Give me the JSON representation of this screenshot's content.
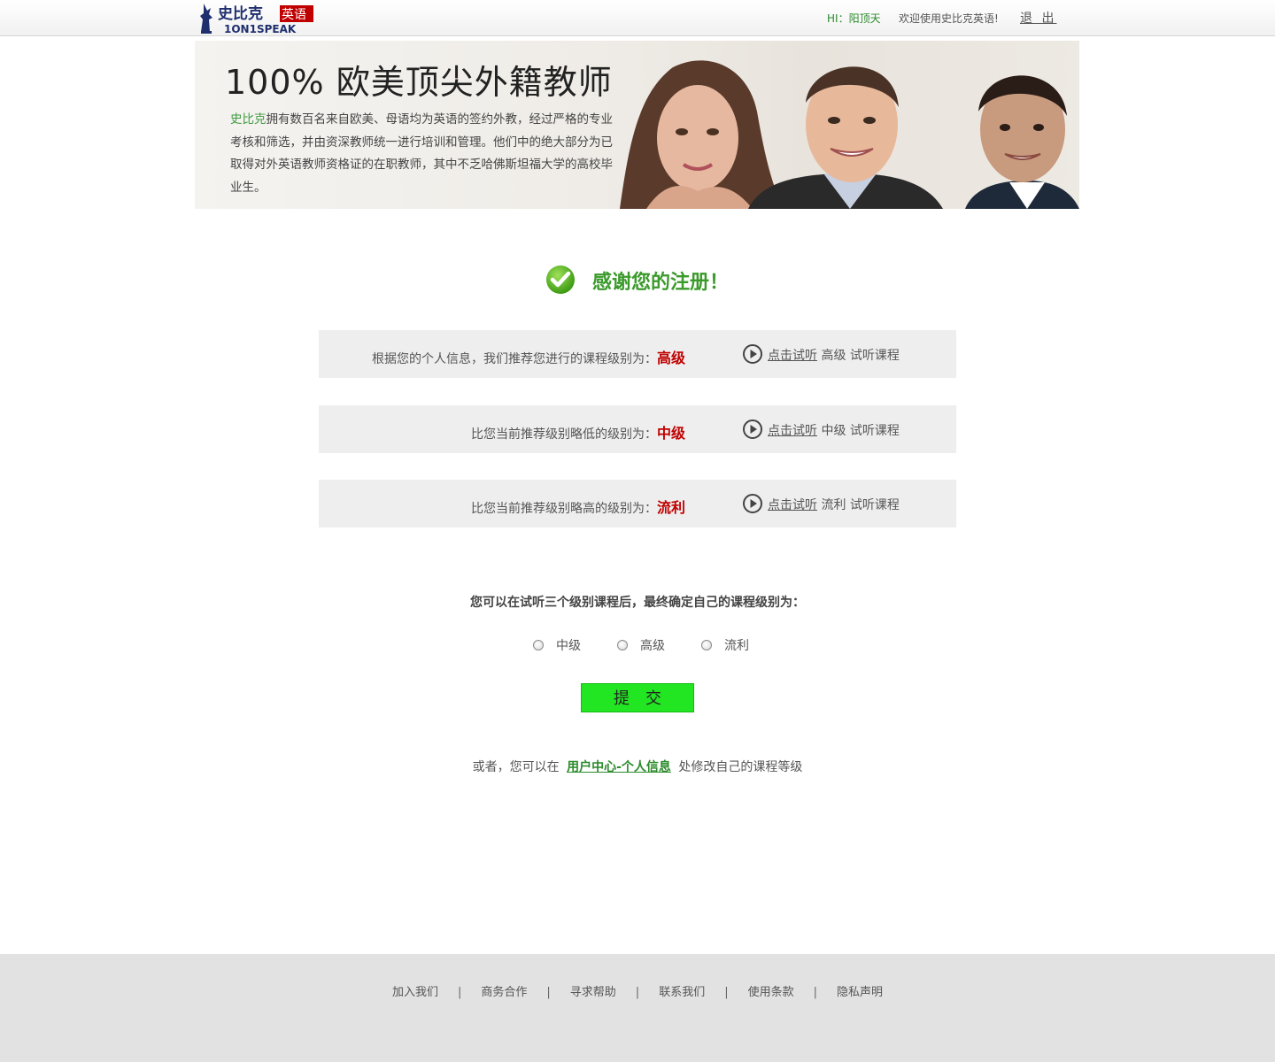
{
  "header": {
    "logo_cn": "史比克",
    "logo_badge": "英语",
    "logo_en": "1ON1SPEAK",
    "greeting_prefix": "HI：",
    "username": "阳顶天",
    "welcome": "欢迎使用史比克英语!",
    "logout": "退 出"
  },
  "banner": {
    "title": "100% 欧美顶尖外籍教师",
    "brand": "史比克",
    "text": "拥有数百名来自欧美、母语均为英语的签约外教，经过严格的专业考核和筛选，并由资深教师统一进行培训和管理。他们中的绝大部分为已取得对外英语教师资格证的在职教师，其中不乏哈佛斯坦福大学的高校毕业生。"
  },
  "thanks": "感谢您的注册！",
  "recommendations": [
    {
      "label": "根据您的个人信息，我们推荐您进行的课程级别为：",
      "level": "高级",
      "link": "点击试听",
      "course_level": "高级",
      "suffix": "试听课程"
    },
    {
      "label": "比您当前推荐级别略低的级别为：",
      "level": "中级",
      "link": "点击试听",
      "course_level": "中级",
      "suffix": "试听课程"
    },
    {
      "label": "比您当前推荐级别略高的级别为：",
      "level": "流利",
      "link": "点击试听",
      "course_level": "流利",
      "suffix": "试听课程"
    }
  ],
  "choose": {
    "label": "您可以在试听三个级别课程后，最终确定自己的课程级别为：",
    "options": [
      "中级",
      "高级",
      "流利"
    ]
  },
  "submit": "提交",
  "or_line": {
    "prefix": "或者，您可以在",
    "link": "用户中心-个人信息",
    "suffix": "处修改自己的课程等级"
  },
  "footer": {
    "links": [
      "加入我们",
      "商务合作",
      "寻求帮助",
      "联系我们",
      "使用条款",
      "隐私声明"
    ],
    "separator": "|"
  },
  "colors": {
    "accent_green": "#3a9a2a",
    "level_red": "#c00000",
    "submit_green": "#22e622"
  }
}
